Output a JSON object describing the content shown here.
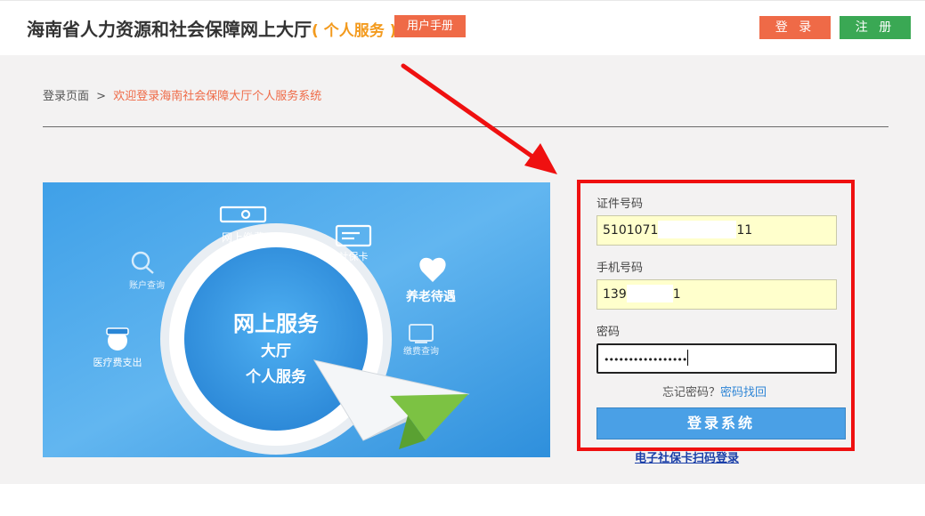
{
  "header": {
    "title": "海南省人力资源和社会保障网上大厅",
    "subtitle": "( 个人服务 )",
    "manual_label": "用户手册",
    "login_label": "登 录",
    "register_label": "注 册"
  },
  "breadcrumb": {
    "home": "登录页面",
    "separator": ">",
    "current": "欢迎登录海南社会保障大厅个人服务系统"
  },
  "banner": {
    "center_title": "网上服务",
    "center_line2": "大厅",
    "center_line3": "个人服务",
    "items": {
      "payment": "网上缴费",
      "social_card": "社保卡",
      "account_query": "账户查询",
      "pension": "养老待遇",
      "medical": "医疗费支出",
      "contribution_query": "缴费查询"
    }
  },
  "login": {
    "id_label": "证件号码",
    "id_value_prefix": "5101071",
    "id_value_suffix": "11",
    "phone_label": "手机号码",
    "phone_value_prefix": "139",
    "phone_value_suffix": "1",
    "password_label": "密码",
    "password_value": "•••••••••••••••••",
    "forgot_text": "忘记密码？",
    "forgot_link": "密码找回",
    "submit_label": "登录系统"
  },
  "ecard_link": "电子社保卡扫码登录",
  "colors": {
    "accent_orange": "#ef6a47",
    "accent_green": "#3aa854",
    "title_orange": "#f39a1d",
    "submit_blue": "#4aa0e6",
    "annotation_red": "#ef1010"
  }
}
